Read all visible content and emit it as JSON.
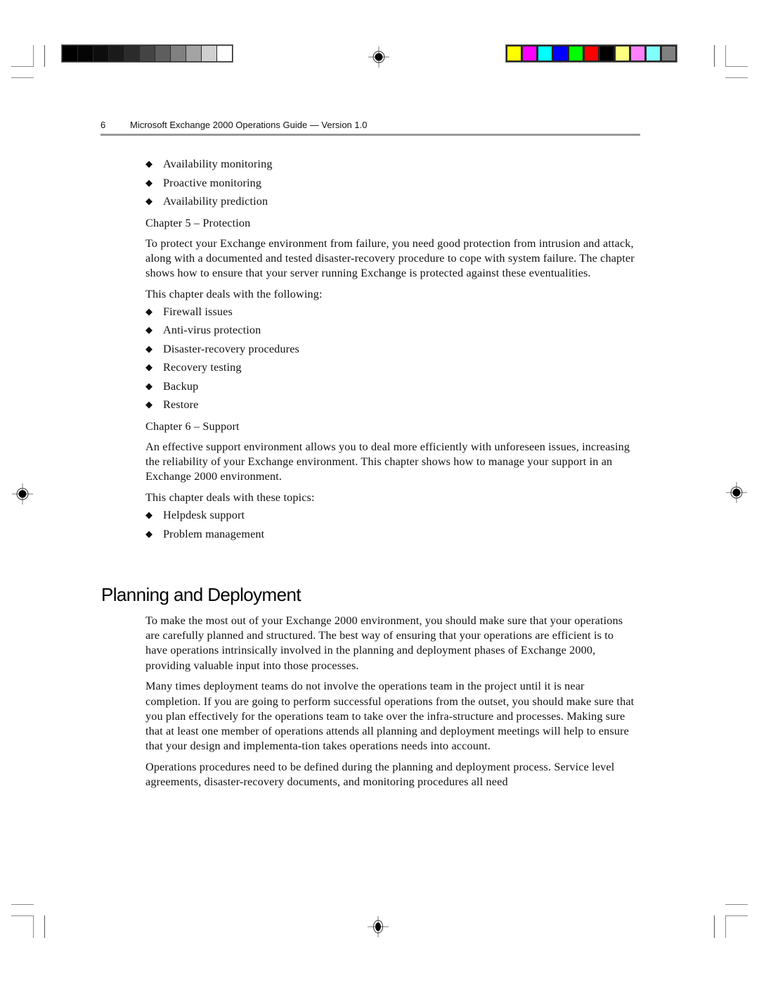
{
  "print_marks": {
    "grayscale_swatches": [
      "#000000",
      "#050505",
      "#0d0d0d",
      "#1a1a1a",
      "#2b2b2b",
      "#444444",
      "#5e5e5e",
      "#808080",
      "#a3a3a3",
      "#d0d0d0",
      "#ffffff"
    ],
    "color_swatches": [
      "#ffff00",
      "#ff00ff",
      "#00ffff",
      "#0000ff",
      "#00ff00",
      "#ff0000",
      "#000000",
      "#ffff80",
      "#ff80ff",
      "#80ffff",
      "#808080"
    ]
  },
  "header": {
    "page_number": "6",
    "title": "Microsoft Exchange 2000 Operations Guide — Version 1.0"
  },
  "top_bullets": [
    "Availability monitoring",
    "Proactive monitoring",
    "Availability prediction"
  ],
  "chapter5": {
    "heading": "Chapter 5 – Protection",
    "description": "To protect your Exchange environment from failure, you need good protection from intrusion and attack, along with a documented and tested disaster-recovery procedure to cope with system failure. The chapter shows how to ensure that your server running Exchange is protected against these eventualities.",
    "intro": "This chapter deals with the following:",
    "topics": [
      "Firewall issues",
      "Anti-virus protection",
      "Disaster-recovery procedures",
      "Recovery testing",
      "Backup",
      "Restore"
    ]
  },
  "chapter6": {
    "heading": "Chapter 6 – Support",
    "description": "An effective support environment allows you to deal more efficiently with unforeseen issues, increasing the reliability of your Exchange environment. This chapter shows how to manage your support in an Exchange 2000 environment.",
    "intro": "This chapter deals with these topics:",
    "topics": [
      "Helpdesk support",
      "Problem management"
    ]
  },
  "planning": {
    "title": "Planning and Deployment",
    "paragraphs": [
      "To make the most out of your Exchange 2000 environment, you should make sure that your operations are carefully planned and structured. The best way of ensuring that your operations are efficient is to have operations intrinsically involved in the planning and deployment phases of Exchange 2000, providing valuable input into those processes.",
      "Many times deployment teams do not involve the operations team in the project until it is near completion. If you are going to perform successful operations from the outset, you should make sure that you plan effectively for the operations team to take over the infra-structure and processes. Making sure that at least one member of operations attends all planning and deployment meetings will help to ensure that your design and implementa-tion takes operations needs into account.",
      "Operations procedures need to be defined during the planning and deployment process. Service level agreements, disaster-recovery documents, and monitoring procedures all need"
    ]
  }
}
